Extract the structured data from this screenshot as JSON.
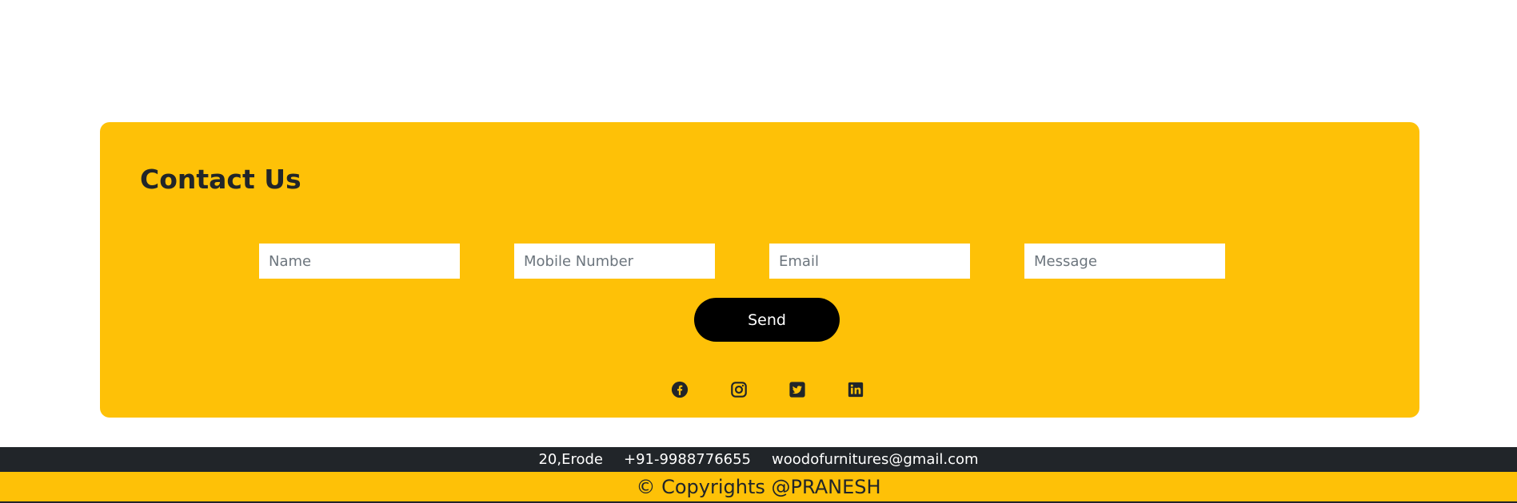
{
  "contact": {
    "title": "Contact Us",
    "fields": {
      "name_placeholder": "Name",
      "mobile_placeholder": "Mobile Number",
      "email_placeholder": "Email",
      "message_placeholder": "Message"
    },
    "send_label": "Send",
    "social_icons": [
      "facebook-icon",
      "instagram-icon",
      "twitter-icon",
      "linkedin-icon"
    ]
  },
  "footer": {
    "address": "20,Erode",
    "phone": "+91-9988776655",
    "email": "woodofurnitures@gmail.com",
    "copyright": "© Copyrights @PRANESH"
  },
  "colors": {
    "accent": "#fec107",
    "dark": "#212529",
    "button": "#000000"
  }
}
